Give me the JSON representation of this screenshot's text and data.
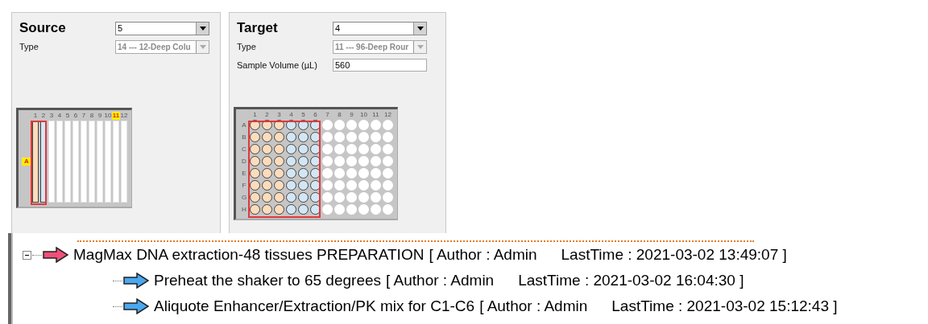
{
  "panels": [
    {
      "title": "Source",
      "selector": {
        "value": "5",
        "disabled": false
      },
      "type_label": "Type",
      "type": {
        "value": "14 --- 12-Deep Colu",
        "disabled": true
      },
      "plate": {
        "kind": "strips",
        "rows": [
          {
            "label": "A",
            "highlighted": true
          }
        ],
        "columns": [
          {
            "label": "1",
            "color": "#fddcbc",
            "selected": true,
            "highlighted": false
          },
          {
            "label": "2",
            "color": "#d3e6f5",
            "selected": true,
            "highlighted": false
          },
          {
            "label": "3",
            "color": "#ffffff",
            "selected": false,
            "highlighted": false
          },
          {
            "label": "4",
            "color": "#ffffff",
            "selected": false,
            "highlighted": false
          },
          {
            "label": "5",
            "color": "#ffffff",
            "selected": false,
            "highlighted": false
          },
          {
            "label": "6",
            "color": "#ffffff",
            "selected": false,
            "highlighted": false
          },
          {
            "label": "7",
            "color": "#ffffff",
            "selected": false,
            "highlighted": false
          },
          {
            "label": "8",
            "color": "#ffffff",
            "selected": false,
            "highlighted": false
          },
          {
            "label": "9",
            "color": "#ffffff",
            "selected": false,
            "highlighted": false
          },
          {
            "label": "10",
            "color": "#ffffff",
            "selected": false,
            "highlighted": false
          },
          {
            "label": "11",
            "color": "#ffffff",
            "selected": false,
            "highlighted": true
          },
          {
            "label": "12",
            "color": "#ffffff",
            "selected": false,
            "highlighted": false
          }
        ]
      }
    },
    {
      "title": "Target",
      "selector": {
        "value": "4",
        "disabled": false
      },
      "type_label": "Type",
      "type": {
        "value": "11 --- 96-Deep Rour",
        "disabled": true
      },
      "volume": {
        "label": "Sample Volume (µL)",
        "value": "560"
      },
      "plate": {
        "kind": "wells",
        "rows": [
          {
            "label": "A",
            "highlighted": false
          },
          {
            "label": "B",
            "highlighted": false
          },
          {
            "label": "C",
            "highlighted": false
          },
          {
            "label": "D",
            "highlighted": false
          },
          {
            "label": "E",
            "highlighted": false
          },
          {
            "label": "F",
            "highlighted": false
          },
          {
            "label": "G",
            "highlighted": false
          },
          {
            "label": "H",
            "highlighted": false
          }
        ],
        "columns": [
          {
            "label": "1",
            "color": "#fddcbc",
            "selected": true,
            "highlighted": false
          },
          {
            "label": "2",
            "color": "#fddcbc",
            "selected": true,
            "highlighted": false
          },
          {
            "label": "3",
            "color": "#fddcbc",
            "selected": true,
            "highlighted": false
          },
          {
            "label": "4",
            "color": "#d3e6f5",
            "selected": true,
            "highlighted": false
          },
          {
            "label": "5",
            "color": "#d3e6f5",
            "selected": true,
            "highlighted": false
          },
          {
            "label": "6",
            "color": "#d3e6f5",
            "selected": true,
            "highlighted": false
          },
          {
            "label": "7",
            "color": "#ffffff",
            "selected": false,
            "highlighted": false
          },
          {
            "label": "8",
            "color": "#ffffff",
            "selected": false,
            "highlighted": false
          },
          {
            "label": "9",
            "color": "#ffffff",
            "selected": false,
            "highlighted": false
          },
          {
            "label": "10",
            "color": "#ffffff",
            "selected": false,
            "highlighted": false
          },
          {
            "label": "11",
            "color": "#ffffff",
            "selected": false,
            "highlighted": false
          },
          {
            "label": "12",
            "color": "#ffffff",
            "selected": false,
            "highlighted": false
          }
        ]
      }
    }
  ],
  "tree": [
    {
      "name": "MagMax DNA extraction-48 tissues PREPARATION",
      "author": "[ Author : Admin",
      "last_time": "LastTime : 2021-03-02 13:49:07 ]",
      "color": "#f0507a",
      "expanded": true,
      "children": [
        {
          "name": "Preheat the shaker to 65 degrees",
          "author": "[ Author : Admin",
          "last_time": "LastTime : 2021-03-02 16:04:30 ]",
          "color": "#4aa8f0"
        },
        {
          "name": "Aliquote Enhancer/Extraction/PK mix for C1-C6",
          "author": "[ Author : Admin",
          "last_time": "LastTime : 2021-03-02 15:12:43 ]",
          "color": "#4aa8f0"
        }
      ]
    }
  ]
}
